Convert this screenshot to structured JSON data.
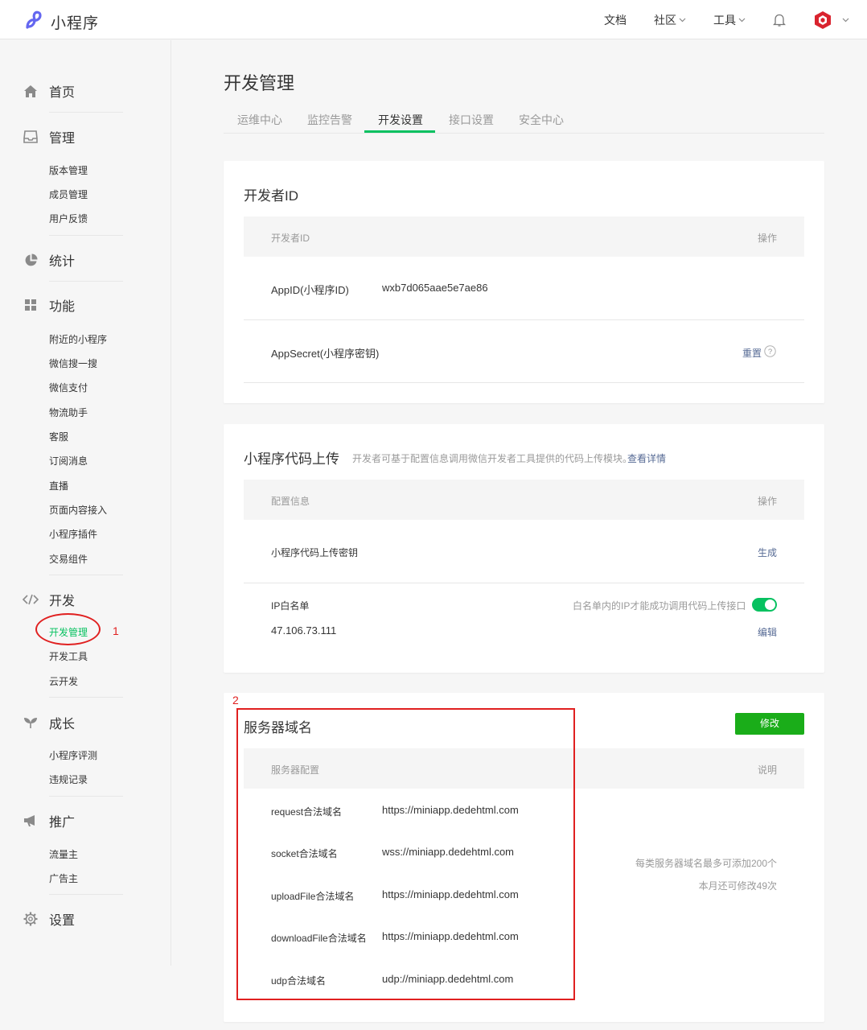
{
  "topbar": {
    "brand": "小程序",
    "nav": [
      "文档",
      "社区",
      "工具"
    ]
  },
  "sidebar": {
    "groups": [
      {
        "icon": "home-icon",
        "label": "首页"
      },
      {
        "icon": "inbox-icon",
        "label": "管理"
      },
      {
        "icon": "pie-chart-icon",
        "label": "统计"
      },
      {
        "icon": "grid-icon",
        "label": "功能"
      },
      {
        "icon": "code-icon",
        "label": "开发"
      },
      {
        "icon": "sprout-icon",
        "label": "成长"
      },
      {
        "icon": "megaphone-icon",
        "label": "推广"
      },
      {
        "icon": "gear-icon",
        "label": "设置"
      }
    ],
    "manage_items": [
      "版本管理",
      "成员管理",
      "用户反馈"
    ],
    "feature_items": [
      "附近的小程序",
      "微信搜一搜",
      "微信支付",
      "物流助手",
      "客服",
      "订阅消息",
      "直播",
      "页面内容接入",
      "小程序插件",
      "交易组件"
    ],
    "dev_items": [
      "开发管理",
      "开发工具",
      "云开发"
    ],
    "growth_items": [
      "小程序评测",
      "违规记录"
    ],
    "promo_items": [
      "流量主",
      "广告主"
    ]
  },
  "main": {
    "title": "开发管理",
    "tabs": [
      "运维中心",
      "监控告警",
      "开发设置",
      "接口设置",
      "安全中心"
    ],
    "active_tab": "开发设置"
  },
  "dev_id_card": {
    "title": "开发者ID",
    "col_left": "开发者ID",
    "col_right": "操作",
    "appid_label": "AppID(小程序ID)",
    "appid_value": "wxb7d065aae5e7ae86",
    "secret_label": "AppSecret(小程序密钥)",
    "reset_label": "重置"
  },
  "upload_card": {
    "title": "小程序代码上传",
    "desc": "开发者可基于配置信息调用微信开发者工具提供的代码上传模块。",
    "detail_link": "查看详情",
    "col_left": "配置信息",
    "col_right": "操作",
    "key_label": "小程序代码上传密钥",
    "generate_label": "生成",
    "ip_label": "IP白名单",
    "ip_hint": "白名单内的IP才能成功调用代码上传接口",
    "ip_whitelist_enabled": true,
    "ip_value": "47.106.73.111",
    "edit_label": "编辑"
  },
  "server_card": {
    "title": "服务器域名",
    "modify_label": "修改",
    "col_left": "服务器配置",
    "col_right": "说明",
    "rows": [
      {
        "label": "request合法域名",
        "value": "https://miniapp.dedehtml.com"
      },
      {
        "label": "socket合法域名",
        "value": "wss://miniapp.dedehtml.com"
      },
      {
        "label": "uploadFile合法域名",
        "value": "https://miniapp.dedehtml.com"
      },
      {
        "label": "downloadFile合法域名",
        "value": "https://miniapp.dedehtml.com"
      },
      {
        "label": "udp合法域名",
        "value": "udp://miniapp.dedehtml.com"
      }
    ],
    "note_1": "每类服务器域名最多可添加200个",
    "note_2": "本月还可修改49次"
  },
  "annotations": {
    "num_1": "1",
    "num_2": "2",
    "color": "#e02020"
  },
  "colors": {
    "accent_green": "#07c160",
    "button_green": "#1aad19",
    "link_blue": "#576b95",
    "brand_purple": "#6467f0"
  }
}
